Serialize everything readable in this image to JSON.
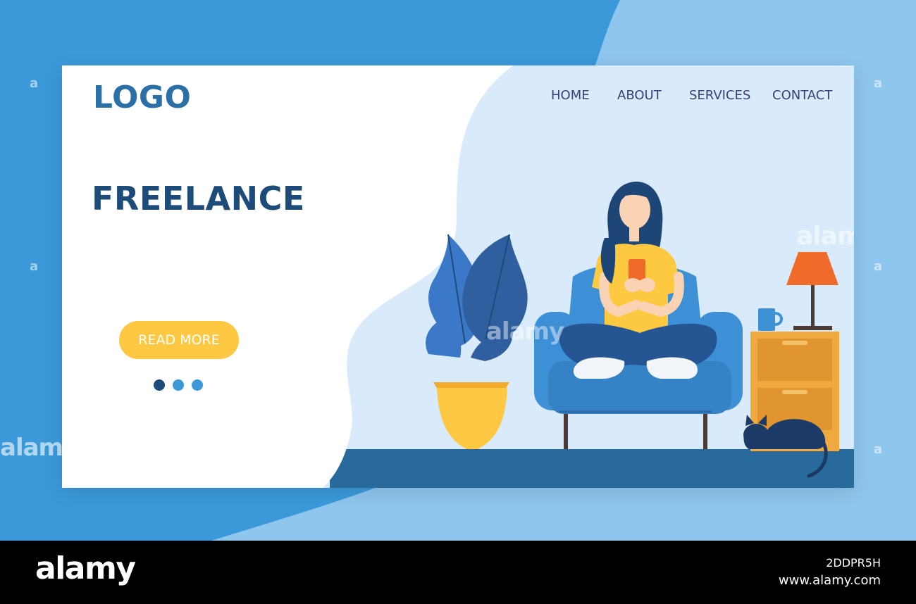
{
  "header": {
    "logo_text": "LOGO",
    "nav": [
      {
        "label": "HOME"
      },
      {
        "label": "ABOUT"
      },
      {
        "label": "SERVICES"
      },
      {
        "label": "CONTACT"
      }
    ]
  },
  "hero": {
    "title": "FREELANCE",
    "button_label": "READ MORE",
    "carousel": {
      "total": 3,
      "active": 1
    }
  },
  "watermark": {
    "text": "alamy",
    "letter": "a",
    "image_id": "2DDPR5H",
    "url": "www.alamy.com"
  },
  "colors": {
    "background": "#3b99da",
    "background_light": "#8fc6ee",
    "card_left": "#ffffff",
    "card_right": "#d9ebfa",
    "floor": "#276a9b",
    "brand_dark": "#1d4b7a",
    "nav_text": "#3a3f78",
    "button": "#fec843",
    "armchair": "#3d8fd6",
    "shirt": "#fcc940",
    "lamp_shade": "#f06a2a",
    "nightstand": "#f0a93f"
  },
  "icons": [
    "plant-illustration",
    "armchair-illustration",
    "woman-illustration",
    "phone-icon",
    "lamp-illustration",
    "mug-icon",
    "nightstand-illustration",
    "cat-illustration"
  ]
}
